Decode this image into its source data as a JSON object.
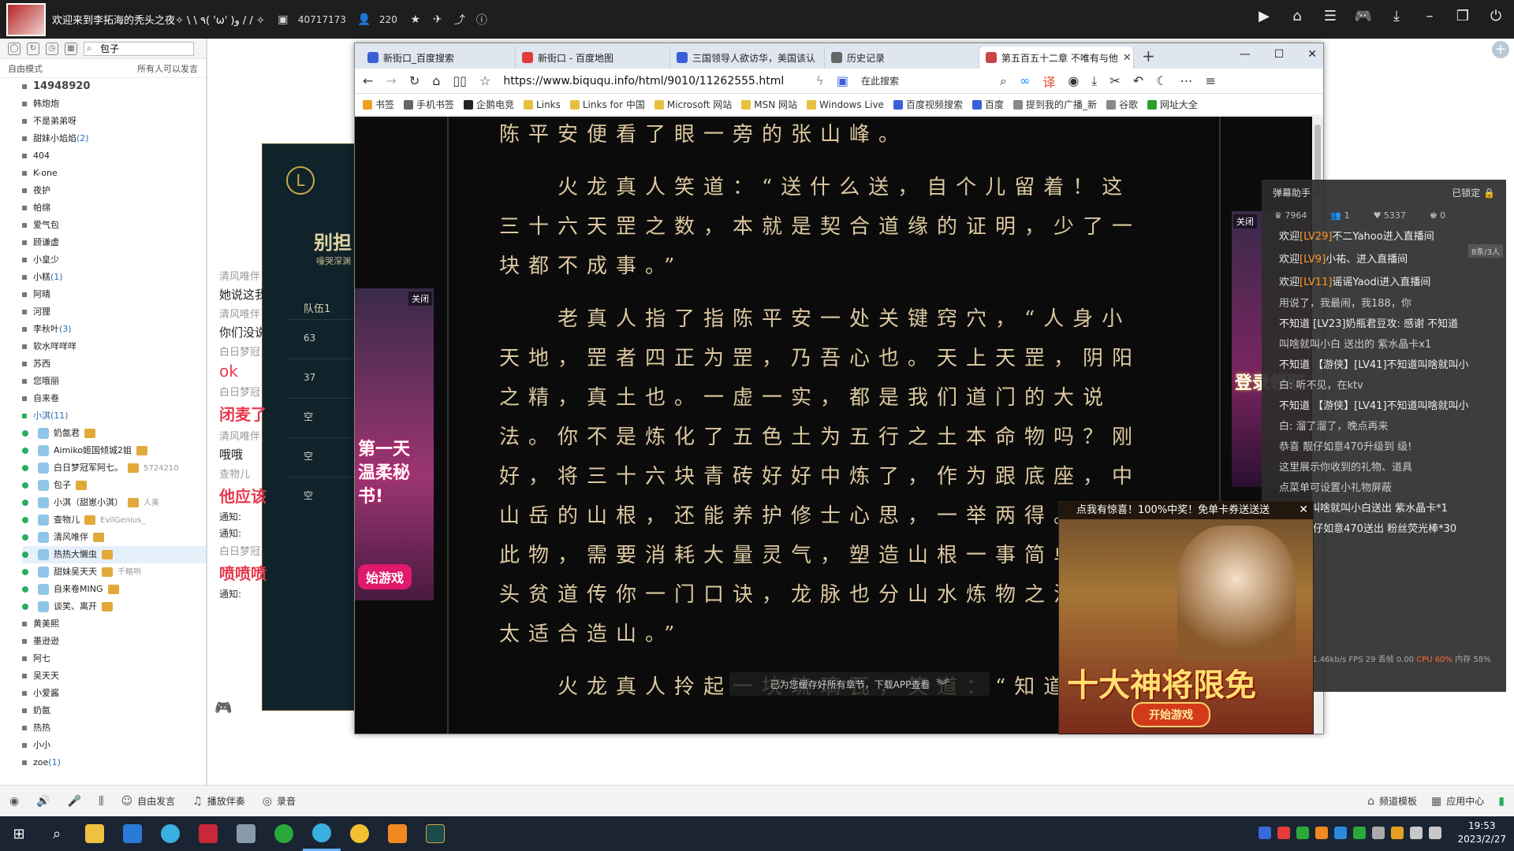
{
  "topbar": {
    "title": "欢迎来到李拓海的秃头之夜✧ \\ \\ ٩( 'ω' )و / / ✧",
    "channel_id": "40717173",
    "online_count": "220"
  },
  "left_panel": {
    "search_value": "包子",
    "mode_label": "自由模式",
    "mode_desc": "所有人可以发言",
    "channel_id_display": "14948920",
    "channels": [
      {
        "name": "韩炮炮",
        "count": ""
      },
      {
        "name": "不是弟弟呀",
        "count": ""
      },
      {
        "name": "甜妹小焰焰",
        "count": "(2)"
      },
      {
        "name": "404",
        "count": ""
      },
      {
        "name": "K-one",
        "count": ""
      },
      {
        "name": "夜护",
        "count": ""
      },
      {
        "name": "帕绵",
        "count": ""
      },
      {
        "name": "爱气包",
        "count": ""
      },
      {
        "name": "顾谦虚",
        "count": ""
      },
      {
        "name": "小皇少",
        "count": ""
      },
      {
        "name": "小糕",
        "count": "(1)"
      },
      {
        "name": "阿晴",
        "count": ""
      },
      {
        "name": "河狸",
        "count": ""
      },
      {
        "name": "李秋叶",
        "count": "(3)"
      },
      {
        "name": "软水咩咩咩",
        "count": ""
      },
      {
        "name": "苏西",
        "count": ""
      },
      {
        "name": "您哦丽",
        "count": ""
      },
      {
        "name": "自来卷",
        "count": ""
      }
    ],
    "active_channel": {
      "name": "小淇",
      "count": "(11)"
    },
    "members": [
      {
        "name": "奶氤君",
        "extra": ""
      },
      {
        "name": "Aimiko姬国倾城2姐",
        "extra": ""
      },
      {
        "name": "白日梦冠军阿七。",
        "extra": "5724210"
      },
      {
        "name": "包子",
        "extra": ""
      },
      {
        "name": "小淇（甜崽小淇）",
        "extra": "人美"
      },
      {
        "name": "查物儿",
        "extra": "EvilGenius_"
      },
      {
        "name": "清风唯伴",
        "extra": ""
      },
      {
        "name": "热热大懒虫",
        "extra": ""
      },
      {
        "name": "甜妹吴天天",
        "extra": "千略咧"
      },
      {
        "name": "自来卷MING",
        "extra": ""
      },
      {
        "name": "谈笑、离开",
        "extra": ""
      }
    ],
    "channels_after": [
      {
        "name": "黄美熙",
        "count": ""
      },
      {
        "name": "墨逊逊",
        "count": ""
      },
      {
        "name": "阿七",
        "count": ""
      },
      {
        "name": "吴天天",
        "count": ""
      },
      {
        "name": "小爱酱",
        "count": ""
      },
      {
        "name": "奶氤",
        "count": ""
      },
      {
        "name": "热热",
        "count": ""
      },
      {
        "name": "小小",
        "count": ""
      },
      {
        "name": "zoe",
        "count": "(1)"
      }
    ]
  },
  "chat_behind": {
    "game_title": "别担",
    "game_sub": "嚎哭深渊",
    "team_label": "队伍1",
    "slots": [
      "63",
      "37",
      "空",
      "空",
      "空"
    ],
    "msgs": [
      {
        "cls": "",
        "text": "清风唯伴"
      },
      {
        "cls": "text",
        "text": "她说这我"
      },
      {
        "cls": "",
        "text": "清风唯伴"
      },
      {
        "cls": "text",
        "text": "你们没说"
      },
      {
        "cls": "",
        "text": "白日梦冠"
      },
      {
        "cls": "ok",
        "text": "ok"
      },
      {
        "cls": "",
        "text": "白日梦冠"
      },
      {
        "cls": "red",
        "text": "闭麦了"
      },
      {
        "cls": "",
        "text": "清风唯伴"
      },
      {
        "cls": "text",
        "text": "哦哦"
      },
      {
        "cls": "",
        "text": "查物儿"
      },
      {
        "cls": "red",
        "text": "他应该"
      },
      {
        "cls": "notice",
        "text": "通知:"
      },
      {
        "cls": "notice",
        "text": "通知:"
      },
      {
        "cls": "",
        "text": "白日梦冠"
      },
      {
        "cls": "red",
        "text": "喷喷喷"
      },
      {
        "cls": "notice",
        "text": "通知:"
      }
    ]
  },
  "browser": {
    "tabs": [
      {
        "label": "新街口_百度搜索",
        "color": "#3a5fd8"
      },
      {
        "label": "新街口 - 百度地图",
        "color": "#e23a3a"
      },
      {
        "label": "三国领导人欲访华，美国该认",
        "color": "#3a5fd8"
      },
      {
        "label": "历史记录",
        "color": "#666"
      },
      {
        "label": "第五百五十二章 不唯有与他",
        "color": "#c44"
      }
    ],
    "url": "https://www.biququ.info/html/9010/11262555.html",
    "search_placeholder": "在此搜索",
    "bookmarks": [
      {
        "label": "书签",
        "color": "#f0a020"
      },
      {
        "label": "手机书签",
        "color": "#666"
      },
      {
        "label": "企鹅电竞",
        "color": "#222"
      },
      {
        "label": "Links",
        "color": "#e8c040"
      },
      {
        "label": "Links for 中国",
        "color": "#e8c040"
      },
      {
        "label": "Microsoft 网站",
        "color": "#e8c040"
      },
      {
        "label": "MSN 网站",
        "color": "#e8c040"
      },
      {
        "label": "Windows Live",
        "color": "#e8c040"
      },
      {
        "label": "百度视频搜索",
        "color": "#3a5fd8"
      },
      {
        "label": "百度",
        "color": "#3a5fd8"
      },
      {
        "label": "提到我的广播_新",
        "color": "#888"
      },
      {
        "label": "谷歌",
        "color": "#888"
      },
      {
        "label": "网址大全",
        "color": "#2aa02a"
      }
    ],
    "novel_paragraphs": [
      "陈平安便看了眼一旁的张山峰。",
      "　　火龙真人笑道：“送什么送，自个儿留着！这三十六天罡之数，本就是契合道缘的证明，少了一块都不成事。”",
      "　　老真人指了指陈平安一处关键窍穴，“人身小天地，罡者四正为罡，乃吾心也。天上天罡，阴阳之精，真土也。一虚一实，都是我们道门的大说法。你不是炼化了五色土为五行之土本命物吗？刚好，将三十六块青砖好好中炼了，作为跟底座，中山岳的山根，还能养护修士心思，一举两得。炼化此物，需要消耗大量灵气，塑造山根一事简单。回头贫道传你一门口诀，龙脉也分山水炼物之法，不太适合造山。”",
      "　　火龙真人拎起一块琉璃瓦，笑道：“知道"
    ],
    "download_hint": "已为您缓存好所有章节，下载APP查看",
    "ad_left": {
      "close": "关闭",
      "text1": "第一天",
      "text2": "温柔秘书!",
      "btn": "始游戏"
    },
    "ad_right": {
      "close": "关闭",
      "text": "登录领取"
    }
  },
  "ad_popup": {
    "title": "点我有惊喜！100%中奖！免单卡券送送送",
    "big_text": "十大神将限免",
    "button": "开始游戏"
  },
  "right_panel": {
    "title": "弹幕助手",
    "locked": "已锁定",
    "stats": [
      "7964",
      "1",
      "5337",
      "0"
    ],
    "lines": [
      {
        "pre": "欢迎",
        "lv": "[LV29]",
        "name": "不二Yahoo",
        "post": "进入直播间"
      },
      {
        "pre": "欢迎",
        "lv": "[LV9]",
        "name": "小祐、",
        "post": "进入直播间"
      },
      {
        "pre": "欢迎",
        "lv": "[LV11]",
        "name": "谣谣Yaodi",
        "post": "进入直播间"
      }
    ],
    "extra_lines": [
      "用说了，我最闹，我188，你",
      "不知道 [LV23]奶瓶君豆攻: 感谢 不知道",
      "叫啥就叫小白 送出的 紫水晶卡x1",
      "不知道 【游侠】[LV41]不知道叫啥就叫小",
      "白: 听不见，在ktv",
      "不知道 【游侠】[LV41]不知道叫啥就叫小",
      "白: 溜了溜了，晚点再来",
      "恭喜 靓仔如意470升级到 级!",
      "这里展示你收到的礼物、道具",
      "点菜单可设置小礼物屏蔽",
      "不知道叫啥就叫小白送出 紫水晶卡*1",
      "仙醋 萌仔如意470送出 粉丝荧光棒*30"
    ],
    "perf": "码率 3851.46kb/s FPS 29 丢帧 0.00",
    "perf_warn": "CPU 60%",
    "perf_mem": "内存 58%",
    "side_count": "8条/3人"
  },
  "bottom_bar": {
    "items": [
      "自由发言",
      "播放伴奏",
      "录音"
    ],
    "right_items": [
      "频道模板",
      "应用中心"
    ]
  },
  "taskbar": {
    "time": "19:53",
    "date": "2023/2/27"
  }
}
